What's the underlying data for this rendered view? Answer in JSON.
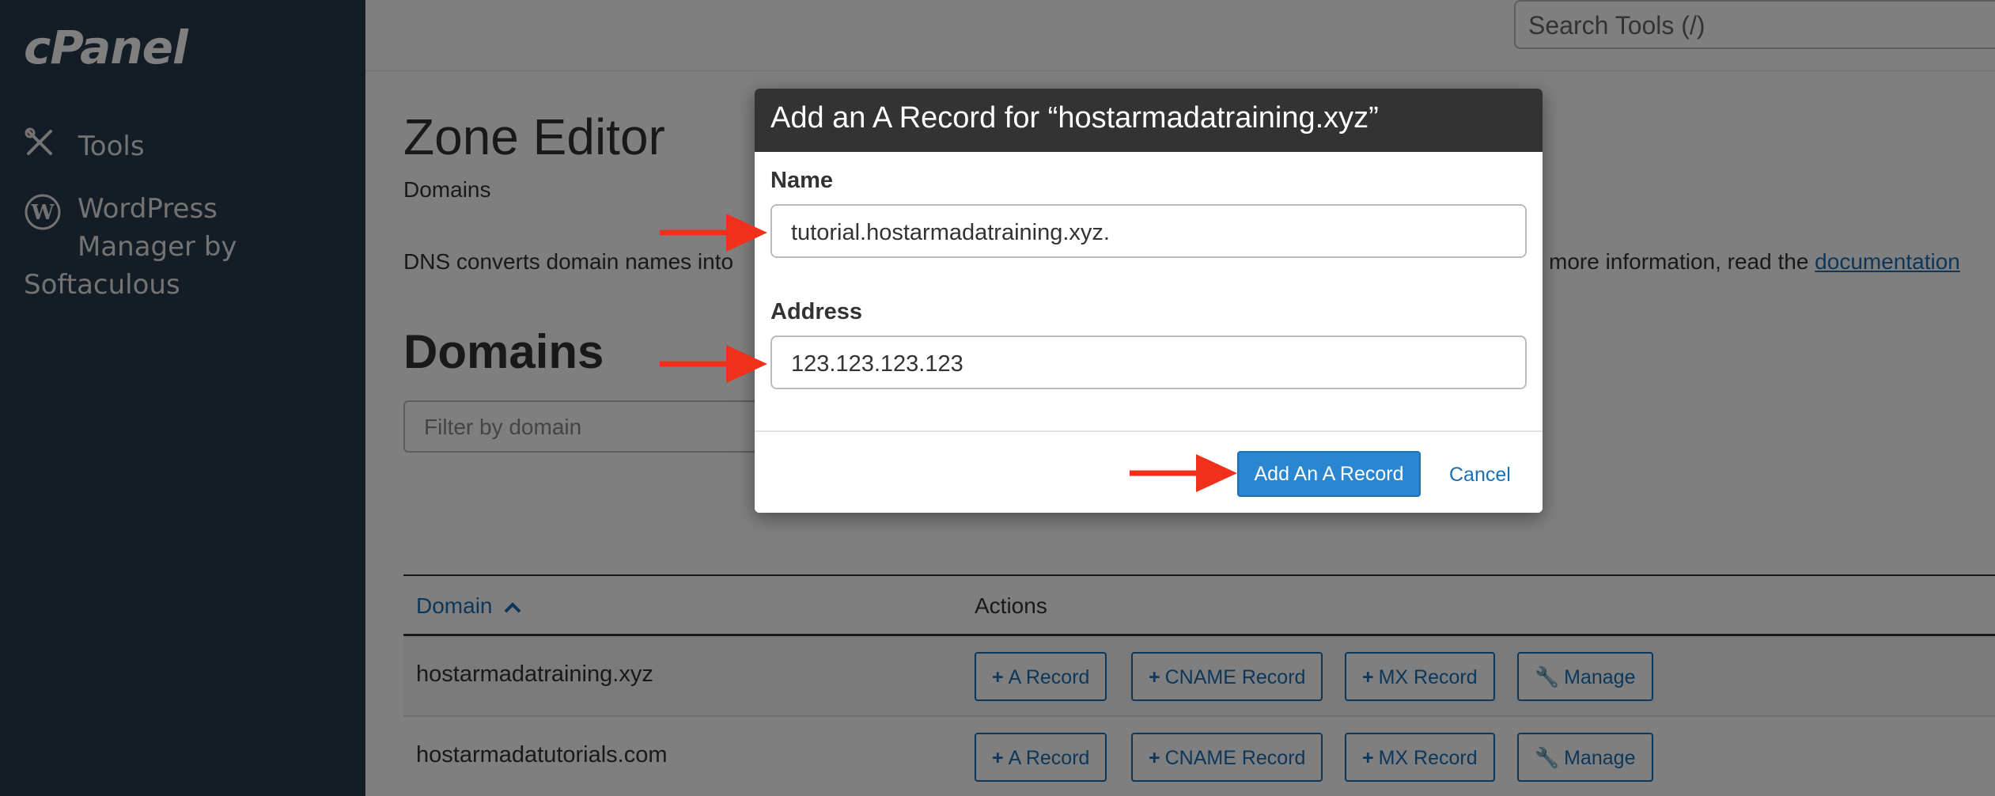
{
  "sidebar": {
    "logo": "cPanel",
    "items": [
      {
        "label": "Tools",
        "icon": "tools-icon"
      },
      {
        "label_line1": "WordPress",
        "label_line2": "Manager by",
        "label_line3": "Softaculous",
        "icon": "wordpress-icon"
      }
    ]
  },
  "topbar": {
    "search_placeholder": "Search Tools (/)"
  },
  "page": {
    "title": "Zone Editor",
    "breadcrumb": "Domains",
    "description_start": "DNS converts domain names into",
    "description_end": "more information, read the ",
    "documentation_link": "documentation",
    "section_title": "Domains",
    "filter_placeholder": "Filter by domain"
  },
  "table": {
    "columns": [
      "Domain",
      "Actions"
    ],
    "rows": [
      {
        "domain": "hostarmadatraining.xyz",
        "actions": [
          "A Record",
          "CNAME Record",
          "MX Record",
          "Manage"
        ]
      },
      {
        "domain": "hostarmadatutorials.com",
        "actions": [
          "A Record",
          "CNAME Record",
          "MX Record",
          "Manage"
        ]
      }
    ]
  },
  "modal": {
    "title": "Add an A Record for “hostarmadatraining.xyz”",
    "name_label": "Name",
    "name_value": "tutorial.hostarmadatraining.xyz.",
    "address_label": "Address",
    "address_value": "123.123.123.123",
    "submit_label": "Add An A Record",
    "cancel_label": "Cancel"
  },
  "colors": {
    "sidebar_bg": "#293a4a",
    "accent": "#1a6fb5",
    "primary_button": "#2a86d1",
    "annotation_arrow": "#f0301a"
  }
}
